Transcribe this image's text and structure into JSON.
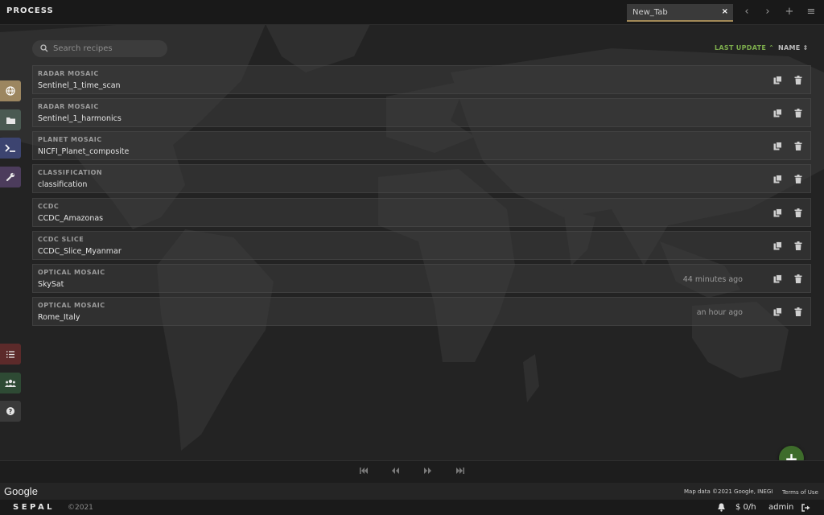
{
  "header": {
    "title": "PROCESS",
    "tab_label": "New_Tab",
    "tab_close": "×",
    "prev": "‹",
    "next": "›",
    "add": "+",
    "menu": "≡"
  },
  "search": {
    "placeholder": "Search recipes"
  },
  "sort": {
    "last_update": "LAST UPDATE ⌃",
    "name": "NAME ⇕"
  },
  "recipes": [
    {
      "type": "RADAR MOSAIC",
      "name": "Sentinel_1_time_scan",
      "updated": ""
    },
    {
      "type": "RADAR MOSAIC",
      "name": "Sentinel_1_harmonics",
      "updated": ""
    },
    {
      "type": "PLANET MOSAIC",
      "name": "NICFI_Planet_composite",
      "updated": ""
    },
    {
      "type": "CLASSIFICATION",
      "name": "classification",
      "updated": ""
    },
    {
      "type": "CCDC",
      "name": "CCDC_Amazonas",
      "updated": ""
    },
    {
      "type": "CCDC SLICE",
      "name": "CCDC_Slice_Myanmar",
      "updated": ""
    },
    {
      "type": "OPTICAL MOSAIC",
      "name": "SkySat",
      "updated": "44 minutes ago"
    },
    {
      "type": "OPTICAL MOSAIC",
      "name": "Rome_Italy",
      "updated": "an hour ago"
    }
  ],
  "sidebar_icons": [
    "globe-icon",
    "folder-icon",
    "terminal-icon",
    "wrench-icon",
    "tasks-icon",
    "users-icon",
    "help-icon"
  ],
  "colors": {
    "accent_green": "#7cac4c",
    "fab_green": "#3e6c2b",
    "tab_underline": "#a38a58",
    "sidebar_process": "#9c8660",
    "sidebar_browse": "#4a5a52",
    "sidebar_terminal": "#3c4470",
    "sidebar_apps": "#4c3c5c",
    "sidebar_tasks": "#5c2a2a",
    "sidebar_users": "#2e4a34",
    "sidebar_help": "#3a3a3a"
  },
  "fab": {
    "label": "+"
  },
  "map": {
    "logo": "Google",
    "attribution": "Map data ©2021 Google, INEGI",
    "terms": "Terms of Use"
  },
  "footer": {
    "brand": "SEPAL",
    "copyright": "©2021",
    "budget": "$ 0/h",
    "user": "admin"
  }
}
